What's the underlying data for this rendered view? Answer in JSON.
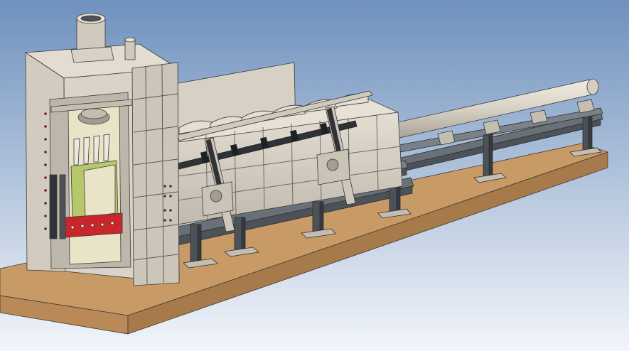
{
  "viewport": {
    "background_top": "#6f91bd",
    "background_bottom": "#f2f5fa"
  },
  "colors": {
    "steel_light": "#d9d3c9",
    "steel_mid": "#c3bdb2",
    "steel_dark": "#a39d93",
    "edge": "#3c3a36",
    "beam_dark": "#4c5258",
    "beam_mid": "#6a7077",
    "ground_top": "#c79a66",
    "ground_front": "#b98a57",
    "ground_side": "#a67a4a",
    "press_red": "#c8262a",
    "press_green": "#b7c76b",
    "press_cream": "#e9e4c8",
    "hydraulic": "#2f3338"
  }
}
